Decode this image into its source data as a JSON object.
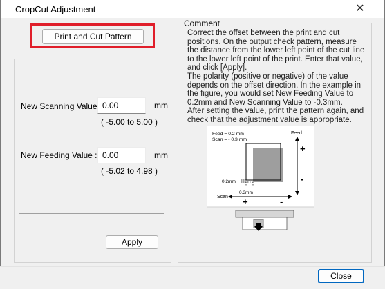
{
  "window": {
    "title": "CropCut Adjustment",
    "close_glyph": "✕"
  },
  "actions": {
    "print_cut_pattern_label": "Print and Cut Pattern",
    "apply_label": "Apply",
    "close_label": "Close"
  },
  "scanning": {
    "label": "New Scanning Value :",
    "value": "0.00",
    "unit": "mm",
    "range": "( -5.00  to  5.00 )"
  },
  "feeding": {
    "label": "New Feeding Value :",
    "value": "0.00",
    "unit": "mm",
    "range": "( -5.02  to  4.98 )"
  },
  "comment": {
    "legend": "Comment",
    "paragraphs": [
      "Correct the offset between the print and cut positions. On the output check pattern, measure the distance from the lower left point of the cut line to the lower left point of the print. Enter that value, and click [Apply].",
      "The polarity (positive or negative) of the value depends on the offset direction. In the example in the figure, you would set New Feeding Value to 0.2mm and New Scanning Value to -0.3mm.",
      "After setting the value, print the pattern again, and check that the adjustment value is appropriate."
    ]
  },
  "figure": {
    "feed_note": "Feed = 0.2 mm",
    "scan_note": "Scan = - 0.3 mm",
    "feed_axis": "Feed",
    "scan_axis": "Scan",
    "plus": "+",
    "minus": "-",
    "measure_feed": "0.2mm",
    "measure_scan": "0.3mm"
  },
  "colors": {
    "highlight": "#e01e2a",
    "default_button_border": "#0067c0"
  }
}
